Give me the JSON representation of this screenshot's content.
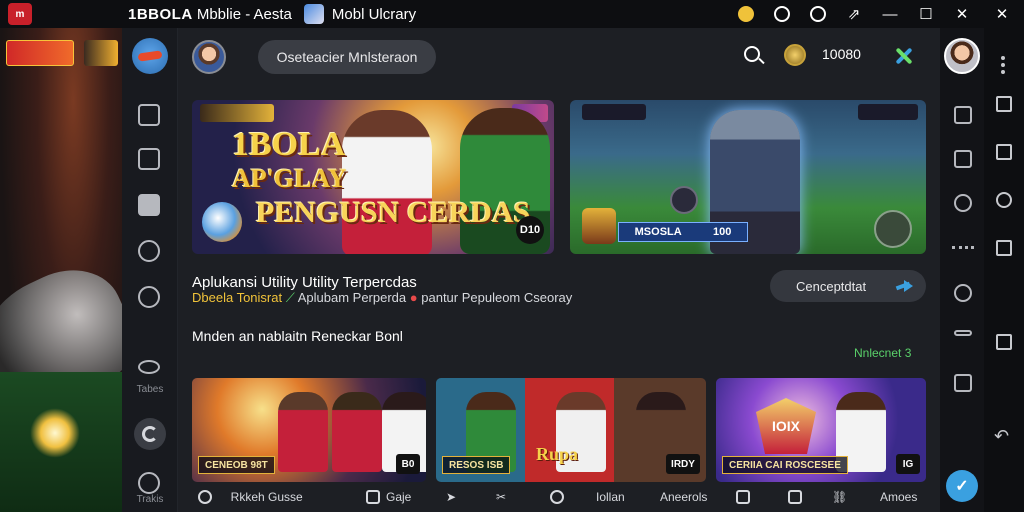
{
  "titlebar": {
    "app_title": "1BBOLA",
    "app_subtitle": "Mbblie - Aesta",
    "tab_title": "Mobl Ulcrary",
    "logo_text": "m",
    "controls": [
      "minimize",
      "maximize",
      "close"
    ]
  },
  "nav": {
    "label_tabes": "Tabes",
    "label_trakis": "Trakis"
  },
  "header": {
    "search_placeholder": "Oseteacier Mnlsteraon",
    "coins": "10080"
  },
  "banners": [
    {
      "line1": "1BOLA",
      "line2": "AP'GLAY",
      "line3": "PENGUSN CERDAS",
      "badge": "D10"
    },
    {
      "name": "MSOSLA",
      "score": "100"
    }
  ],
  "info": {
    "title": "Aplukansi Utility Utility Terpercdas",
    "sub_prefix": "Dbeela Tonisrat",
    "sub_main": "Aplubam Perperda",
    "sub_suffix": "pantur Pepuleom Cseoray",
    "desc": "Mnden an nablaitn Reneckar Bonl",
    "cta_label": "Cenceptdtat",
    "more_link": "Nnlecnet 3"
  },
  "cards": [
    {
      "label": "CENEOB 98T",
      "tag": "B0"
    },
    {
      "label": "RESOS ISB",
      "hero": "Rupa",
      "tag": "IRDY"
    },
    {
      "label": "CERIIA CAI ROSCESEE",
      "logo": "IOIX",
      "tag": "IG"
    }
  ],
  "bottom_bar": {
    "item1": "Rkkeh Gusse",
    "item2": "Gaje",
    "item3": "Iollan",
    "item4": "Aneerols",
    "item5": "Amoes"
  }
}
